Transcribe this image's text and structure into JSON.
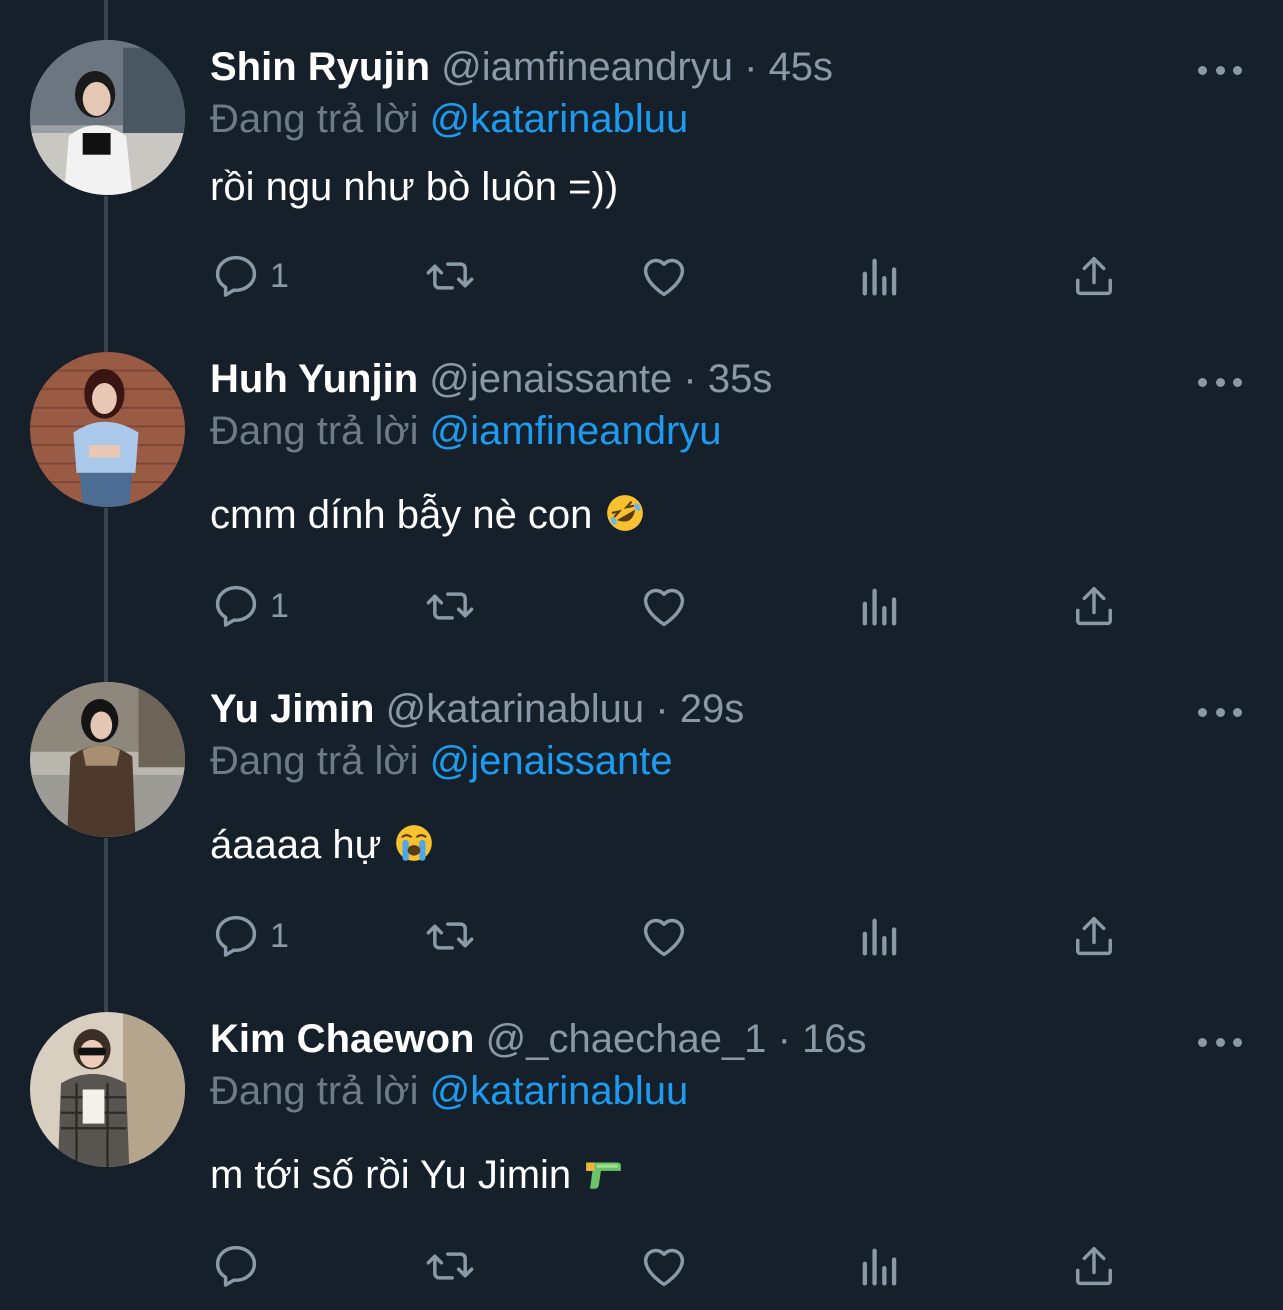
{
  "reply_label": "Đang trả lời",
  "tweets": [
    {
      "name": "Shin Ryujin",
      "handle": "@iamfineandryu",
      "separator": "·",
      "time": "45s",
      "reply_to": "@katarinabluu",
      "text": "rồi ngu như bò luôn =))",
      "reply_count": "1"
    },
    {
      "name": "Huh Yunjin",
      "handle": "@jenaissante",
      "separator": "·",
      "time": "35s",
      "reply_to": "@iamfineandryu",
      "text": "cmm dính bẫy nè con",
      "emoji": "rolling-on-floor-laughing",
      "reply_count": "1"
    },
    {
      "name": "Yu Jimin",
      "handle": "@katarinabluu",
      "separator": "·",
      "time": "29s",
      "reply_to": "@jenaissante",
      "text": "áaaaa hự",
      "emoji": "loudly-crying-face",
      "reply_count": "1"
    },
    {
      "name": "Kim Chaewon",
      "handle": "@_chaechae_1",
      "separator": "·",
      "time": "16s",
      "reply_to": "@katarinabluu",
      "text": "m tới số rồi Yu Jimin",
      "emoji": "water-pistol",
      "reply_count": ""
    }
  ],
  "colors": {
    "background": "#15202b",
    "text": "#ffffff",
    "muted": "#8b98a5",
    "link": "#1d9bf0",
    "thread_line": "#38444d"
  }
}
